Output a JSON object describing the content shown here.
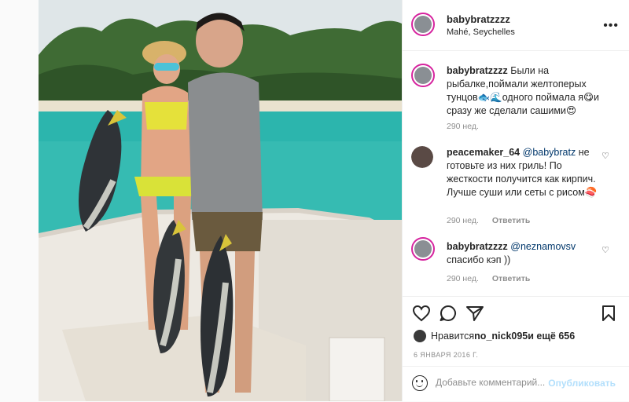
{
  "post": {
    "username": "babybratzzzz",
    "location": "Mahé, Seychelles",
    "more_icon": "more-icon"
  },
  "caption": {
    "username": "babybratzzzz",
    "text": "Были на рыбалке,поймали желтоперых тунцов🐟🌊одного поймала я😋и сразу же сделали сашими😍",
    "time": "290 нед."
  },
  "comments": [
    {
      "username": "peacemaker_64",
      "mention": "@babybratz",
      "text": " не готовьте из них гриль! По жесткости получится как кирпич. Лучше суши или сеты с рисом🍣",
      "time": "290 нед.",
      "reply": "Ответить"
    },
    {
      "username": "babybratzzzz",
      "mention": "@neznamovsv",
      "text": " спасибо кэп ))",
      "time": "290 нед.",
      "reply": "Ответить"
    }
  ],
  "likes": {
    "prefix": "Нравится ",
    "user": "no_nick095",
    "suffix": " и ещё 656"
  },
  "date": "6 ЯНВАРЯ 2016 Г.",
  "add_comment": {
    "placeholder": "Добавьте комментарий...",
    "post_label": "Опубликовать"
  },
  "colors": {
    "accent": "#0095f6",
    "ring": "#d6249f",
    "muted": "#8e8e8e"
  }
}
